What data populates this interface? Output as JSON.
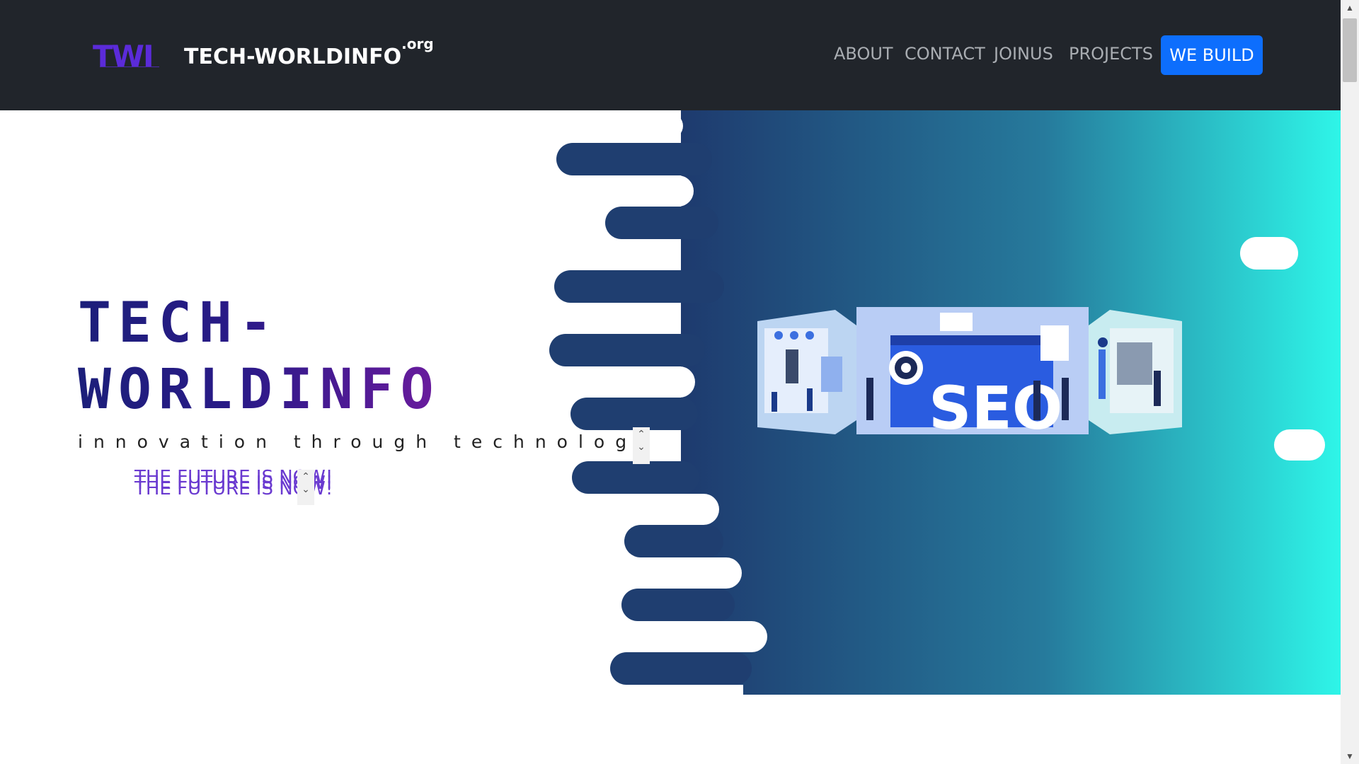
{
  "brand": {
    "logo_text": "TWI",
    "name": "TECH-WORLDINFO",
    "suffix": ".org"
  },
  "nav": {
    "links": [
      "ABOUT",
      "CONTACT",
      "JOINUS",
      "PROJECTS"
    ],
    "cta": "WE BUILD"
  },
  "hero": {
    "title_line1": "TECH-",
    "title_line2": "WORLDINFO",
    "subtitle": "innovation through technology",
    "marquee_text": "THE FUTURE IS NOW!",
    "image_label": "SEO"
  },
  "colors": {
    "navbar": "#21252b",
    "cta": "#0d6efd",
    "gradient_start": "#1e3a6e",
    "gradient_end": "#2ef5e8",
    "title_gradient": [
      "#1c1f7a",
      "#6b1b9e"
    ],
    "marquee": "#6a3ad0"
  },
  "icons": {
    "scroll_up": "chevron-up-icon",
    "scroll_down": "chevron-down-icon"
  }
}
